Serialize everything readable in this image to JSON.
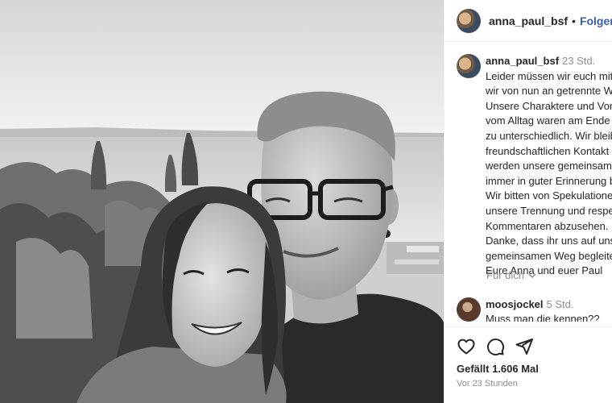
{
  "header": {
    "username": "anna_paul_bsf",
    "separator": "•",
    "follow_label": "Folgen"
  },
  "caption": {
    "username": "anna_paul_bsf",
    "time": "23 Std.",
    "lines": [
      "Leider müssen wir euch mitt",
      "wir von nun an getrennte W",
      "Unsere Charaktere und Vors",
      "vom Alltag waren am Ende l",
      "zu unterschiedlich. Wir bleib",
      "freundschaftlichen Kontakt u",
      "werden unsere gemeinsame",
      "immer in guter Erinnerung b",
      "Wir bitten von Spekulatione",
      "unsere Trennung und respek",
      "Kommentaren abzusehen.",
      "Danke, dass ihr uns auf unse",
      "gemeinsamen Weg begleitet",
      "Eure Anna und euer Paul"
    ],
    "translate_label": "Für dich"
  },
  "comments": [
    {
      "username": "moosjockel",
      "time": "5 Std.",
      "text": "Muss man die kennen??"
    }
  ],
  "footer": {
    "likes": "Gefällt 1.606 Mal",
    "timestamp": "Vor 23 Stunden"
  },
  "icons": {
    "like": "heart-icon",
    "comment": "comment-bubble-icon",
    "share": "paper-plane-icon",
    "translate": "chevron-down-icon"
  },
  "colors": {
    "follow": "#3c5fb3",
    "muted": "#8e8e8e",
    "text": "#262626",
    "border": "#efefef"
  }
}
